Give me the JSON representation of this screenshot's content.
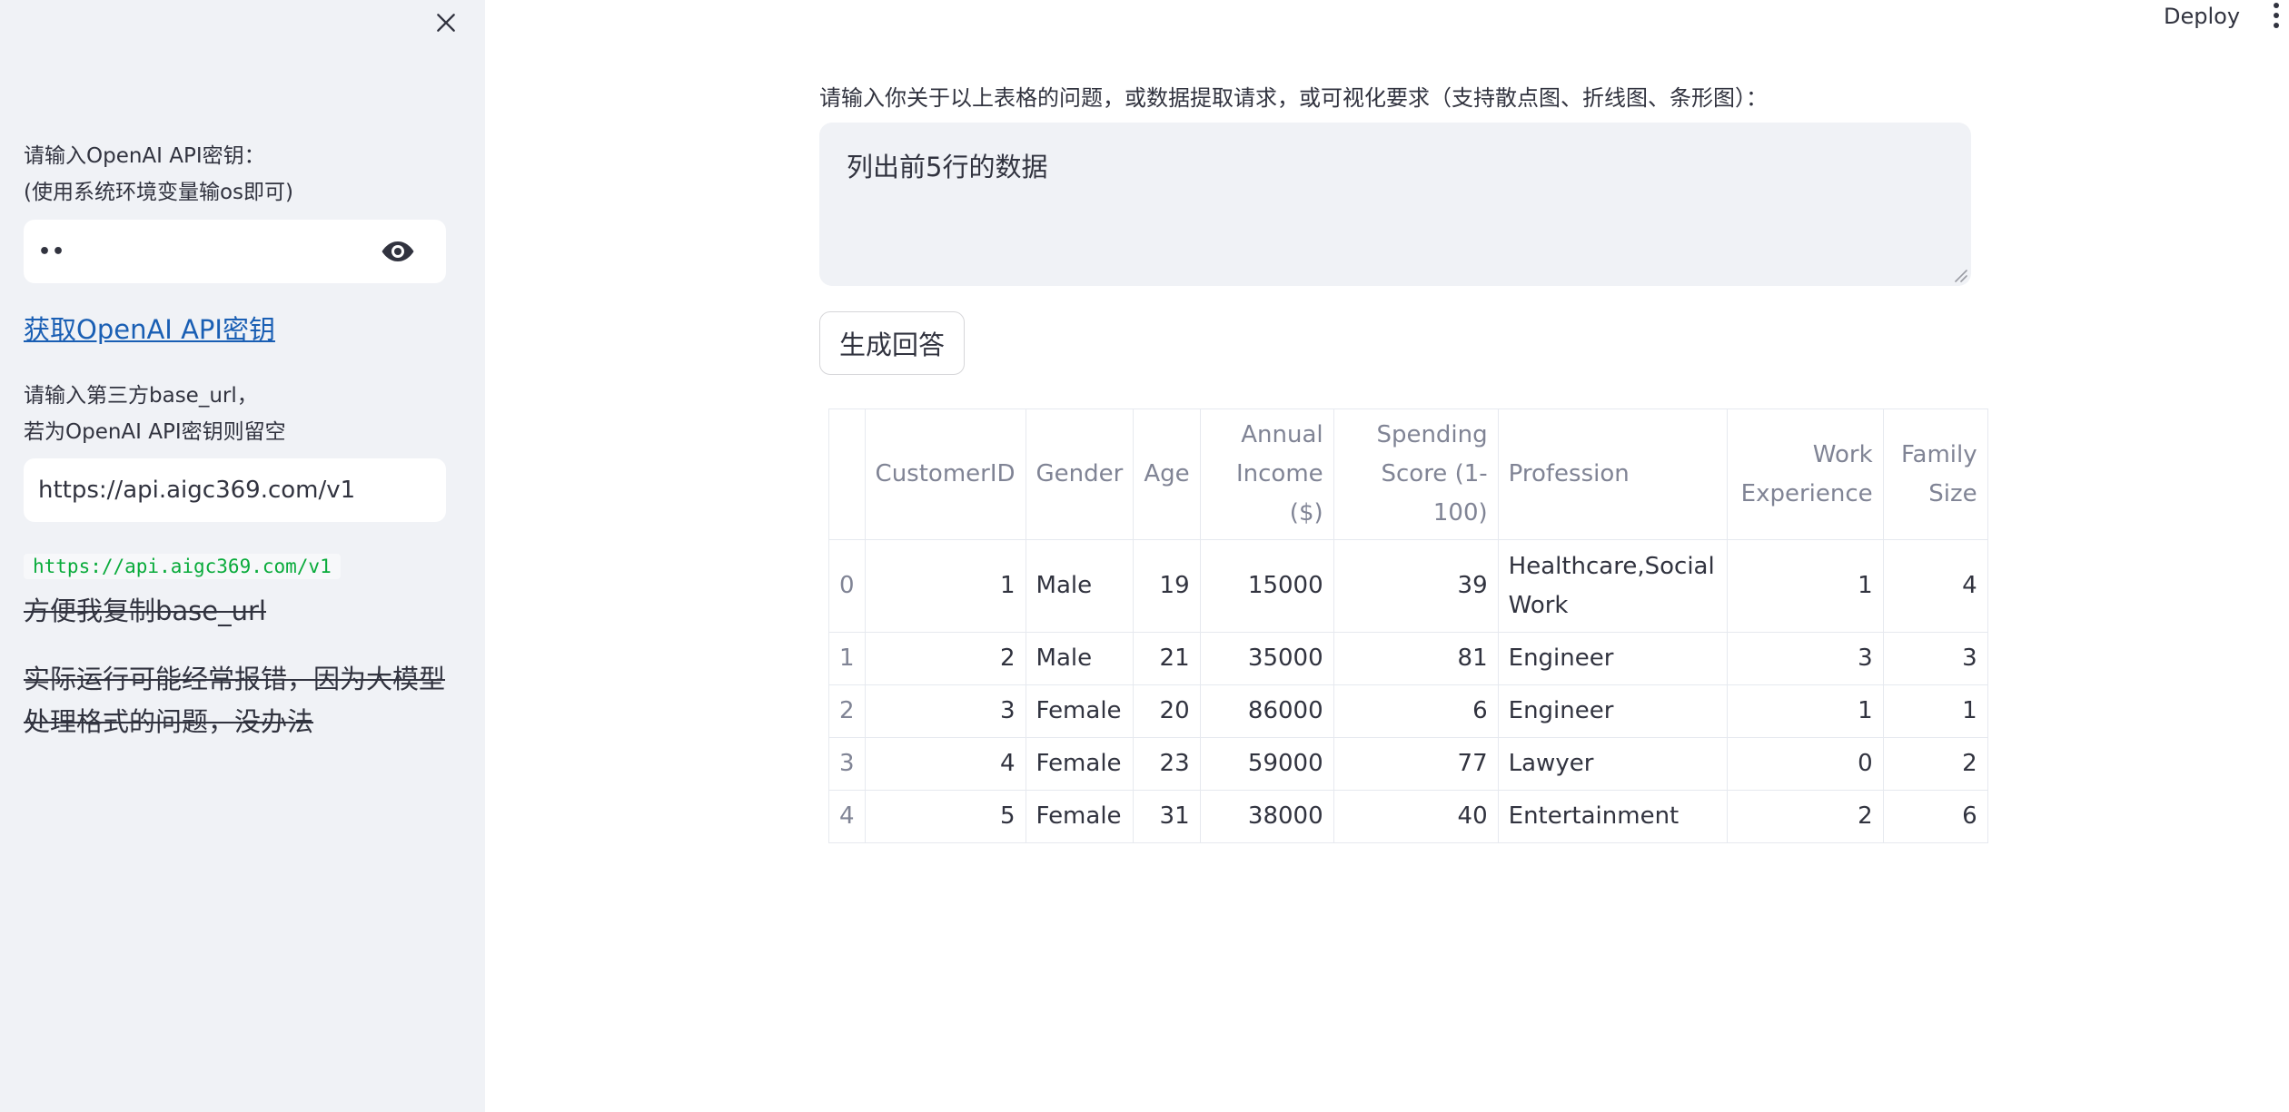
{
  "sidebar": {
    "api_key_label_line1": "请输入OpenAI API密钥：",
    "api_key_label_line2": "(使用系统环境变量输os即可)",
    "api_key_value": "••",
    "api_key_link": "获取OpenAI API密钥",
    "base_url_label_line1": "请输入第三方base_url，",
    "base_url_label_line2": "若为OpenAI API密钥则留空",
    "base_url_value": "https://api.aigc369.com/v1",
    "code_snippet": "https://api.aigc369.com/v1",
    "note1": "方便我复制base_url",
    "note2_line1": "实际运行可能经常报错，因为大模型",
    "note2_line2": "处理格式的问题，没办法"
  },
  "header": {
    "deploy_label": "Deploy"
  },
  "main": {
    "prompt_label": "请输入你关于以上表格的问题，或数据提取请求，或可视化要求（支持散点图、折线图、条形图）：",
    "prompt_value": "列出前5行的数据",
    "generate_button": "生成回答"
  },
  "table": {
    "columns": [
      {
        "line1": "CustomerID",
        "line2": "",
        "line3": ""
      },
      {
        "line1": "Gender",
        "line2": "",
        "line3": ""
      },
      {
        "line1": "Age",
        "line2": "",
        "line3": ""
      },
      {
        "line1": "Annual",
        "line2": "Income",
        "line3": "($)"
      },
      {
        "line1": "Spending",
        "line2": "Score (1-100)",
        "line3": ""
      },
      {
        "line1": "Profession",
        "line2": "",
        "line3": ""
      },
      {
        "line1": "Work",
        "line2": "Experience",
        "line3": ""
      },
      {
        "line1": "Family",
        "line2": "Size",
        "line3": ""
      }
    ],
    "rows": [
      {
        "index": "0",
        "customer_id": "1",
        "gender": "Male",
        "age": "19",
        "income": "15000",
        "score": "39",
        "profession_line1": "Healthcare,Social",
        "profession_line2": "Work",
        "work_exp": "1",
        "family_size": "4"
      },
      {
        "index": "1",
        "customer_id": "2",
        "gender": "Male",
        "age": "21",
        "income": "35000",
        "score": "81",
        "profession_line1": "Engineer",
        "profession_line2": "",
        "work_exp": "3",
        "family_size": "3"
      },
      {
        "index": "2",
        "customer_id": "3",
        "gender": "Female",
        "age": "20",
        "income": "86000",
        "score": "6",
        "profession_line1": "Engineer",
        "profession_line2": "",
        "work_exp": "1",
        "family_size": "1"
      },
      {
        "index": "3",
        "customer_id": "4",
        "gender": "Female",
        "age": "23",
        "income": "59000",
        "score": "77",
        "profession_line1": "Lawyer",
        "profession_line2": "",
        "work_exp": "0",
        "family_size": "2"
      },
      {
        "index": "4",
        "customer_id": "5",
        "gender": "Female",
        "age": "31",
        "income": "38000",
        "score": "40",
        "profession_line1": "Entertainment",
        "profession_line2": "",
        "work_exp": "2",
        "family_size": "6"
      }
    ]
  },
  "icons": {
    "close": "close-icon",
    "eye": "eye-icon",
    "menu": "more-vertical-icon"
  },
  "colors": {
    "sidebar_bg": "#f0f2f6",
    "link": "#1a5fb4",
    "code_text": "#09ab3b",
    "header_text": "#808495"
  }
}
